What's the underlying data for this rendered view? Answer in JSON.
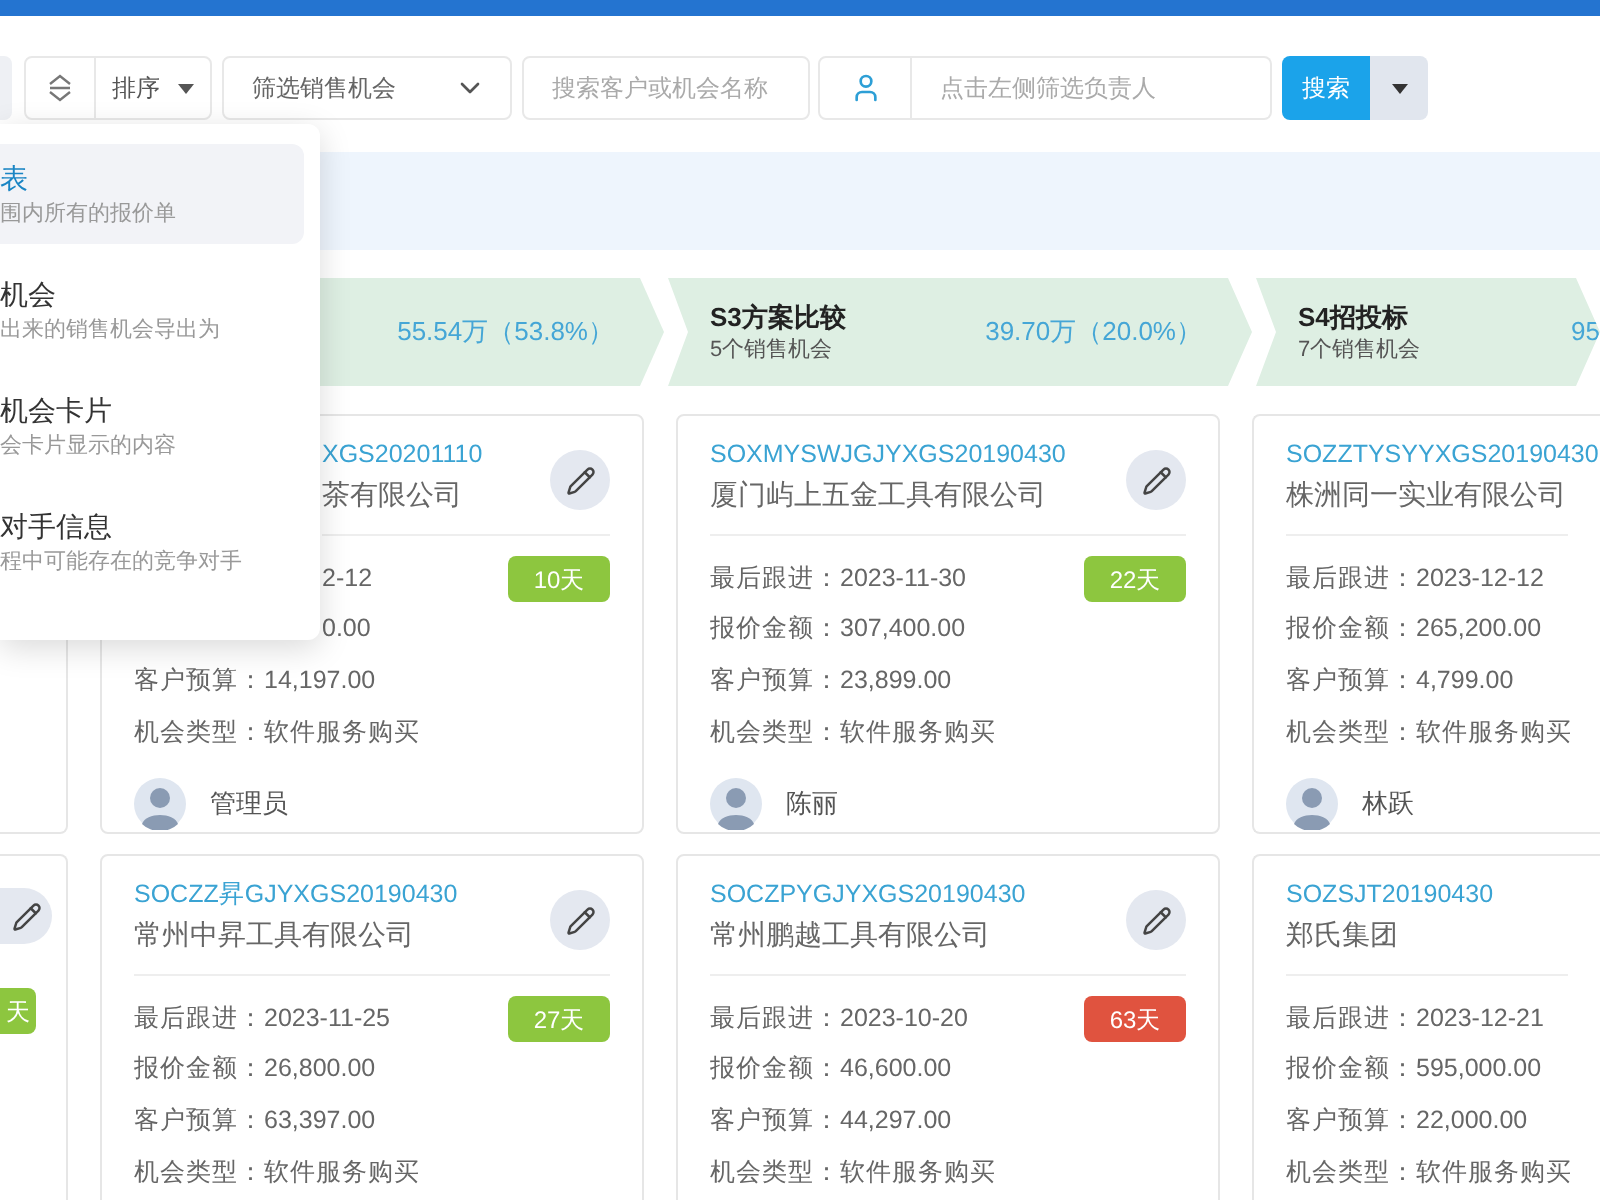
{
  "toolbar": {
    "sort": {
      "label": "排序"
    },
    "filter_select": {
      "value": "筛选销售机会"
    },
    "search": {
      "placeholder": "搜索客户或机会名称"
    },
    "owner_filter": {
      "placeholder": "点击左侧筛选负责人"
    },
    "search_button": {
      "label": "搜索"
    }
  },
  "menu": {
    "items": [
      {
        "title": "表",
        "description": "围内所有的报价单",
        "selected": true
      },
      {
        "title": "机会",
        "description": "出来的销售机会导出为",
        "selected": false
      },
      {
        "title": "机会卡片",
        "description": "会卡片显示的内容",
        "selected": false
      },
      {
        "title": "对手信息",
        "description": "程中可能存在的竞争对手",
        "selected": false
      }
    ]
  },
  "stages": [
    {
      "kind": "edge",
      "value": "55.54万（53.8%）"
    },
    {
      "kind": "full",
      "name": "S3方案比较",
      "count": "5个销售机会",
      "value": "39.70万（20.0%）"
    },
    {
      "kind": "full",
      "name": "S4招投标",
      "count": "7个销售机会",
      "value": "95"
    }
  ],
  "card_rows": [
    {
      "cards": [
        {
          "kind": "edge-left"
        },
        {
          "kind": "covered",
          "id": "XGS20201110",
          "company": "茶有限公司",
          "lines": [
            "2-12",
            "0.00",
            "客户预算：14,197.00",
            "机会类型：软件服务购买"
          ],
          "badge": {
            "text": "10天",
            "color": "#8dc63f"
          },
          "owner": "管理员"
        },
        {
          "kind": "full",
          "id": "SOXMYSWJGJYXGS20190430",
          "company": "厦门屿上五金工具有限公司",
          "lines": [
            "最后跟进：2023-11-30",
            "报价金额：307,400.00",
            "客户预算：23,899.00",
            "机会类型：软件服务购买"
          ],
          "badge": {
            "text": "22天",
            "color": "#8dc63f"
          },
          "owner": "陈丽"
        },
        {
          "kind": "edge-right",
          "id": "SOZZTYSYYXGS20190430",
          "company": "株洲同一实业有限公司",
          "lines": [
            "最后跟进：2023-12-12",
            "报价金额：265,200.00",
            "客户预算：4,799.00",
            "机会类型：软件服务购买"
          ],
          "owner": "林跃"
        }
      ]
    },
    {
      "cards": [
        {
          "kind": "edge-left",
          "badge": {
            "text": "天",
            "color": "#8dc63f"
          }
        },
        {
          "kind": "full",
          "id": "SOCZZ昇GJYXGS20190430",
          "company": "常州中昇工具有限公司",
          "lines": [
            "最后跟进：2023-11-25",
            "报价金额：26,800.00",
            "客户预算：63,397.00",
            "机会类型：软件服务购买"
          ],
          "badge": {
            "text": "27天",
            "color": "#8dc63f"
          }
        },
        {
          "kind": "full",
          "id": "SOCZPYGJYXGS20190430",
          "company": "常州鹏越工具有限公司",
          "lines": [
            "最后跟进：2023-10-20",
            "报价金额：46,600.00",
            "客户预算：44,297.00",
            "机会类型：软件服务购买"
          ],
          "badge": {
            "text": "63天",
            "color": "#e0533f"
          }
        },
        {
          "kind": "edge-right",
          "id": "SOZSJT20190430",
          "company": "郑氏集团",
          "lines": [
            "最后跟进：2023-12-21",
            "报价金额：595,000.00",
            "客户预算：22,000.00",
            "机会类型：软件服务购买"
          ]
        }
      ]
    }
  ]
}
